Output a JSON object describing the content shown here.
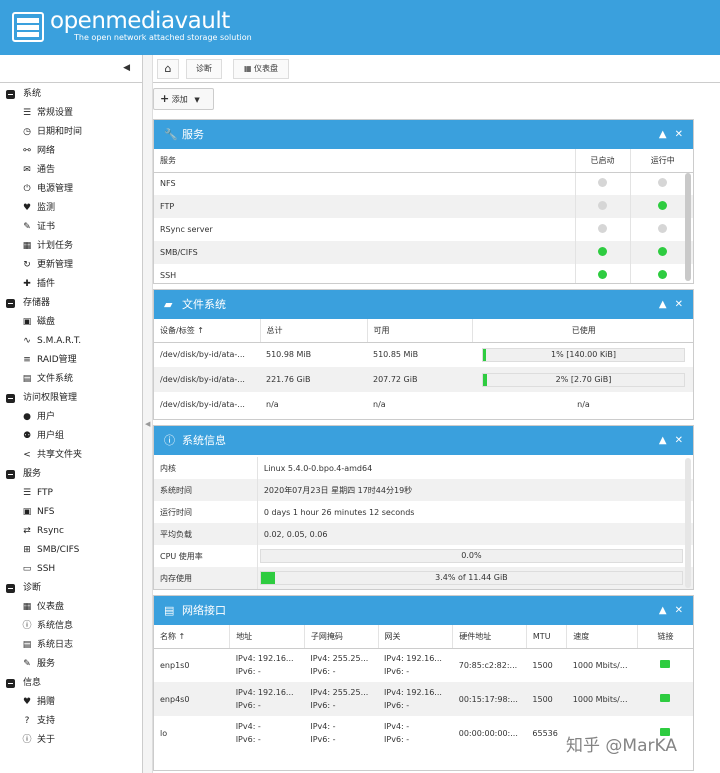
{
  "app": {
    "brand": "openmediavault",
    "tagline": "The open network attached storage solution"
  },
  "toolbar": {
    "home_icon": "home-icon",
    "crumb1": "诊断",
    "crumb2": "仪表盘",
    "add_label": "添加"
  },
  "sidebar": [
    {
      "group": "系统",
      "items": [
        {
          "icon": "☰",
          "label": "常规设置"
        },
        {
          "icon": "◷",
          "label": "日期和时间"
        },
        {
          "icon": "⚯",
          "label": "网络"
        },
        {
          "icon": "✉",
          "label": "通告"
        },
        {
          "icon": "⏻",
          "label": "电源管理"
        },
        {
          "icon": "♥",
          "label": "监测"
        },
        {
          "icon": "✎",
          "label": "证书"
        },
        {
          "icon": "▦",
          "label": "计划任务"
        },
        {
          "icon": "↻",
          "label": "更新管理"
        },
        {
          "icon": "✚",
          "label": "插件"
        }
      ]
    },
    {
      "group": "存储器",
      "items": [
        {
          "icon": "▣",
          "label": "磁盘"
        },
        {
          "icon": "∿",
          "label": "S.M.A.R.T."
        },
        {
          "icon": "≡",
          "label": "RAID管理"
        },
        {
          "icon": "▤",
          "label": "文件系统"
        }
      ]
    },
    {
      "group": "访问权限管理",
      "items": [
        {
          "icon": "●",
          "label": "用户"
        },
        {
          "icon": "⚉",
          "label": "用户组"
        },
        {
          "icon": "<",
          "label": "共享文件夹"
        }
      ]
    },
    {
      "group": "服务",
      "items": [
        {
          "icon": "☰",
          "label": "FTP"
        },
        {
          "icon": "▣",
          "label": "NFS"
        },
        {
          "icon": "⇄",
          "label": "Rsync"
        },
        {
          "icon": "⊞",
          "label": "SMB/CIFS"
        },
        {
          "icon": "▭",
          "label": "SSH"
        }
      ]
    },
    {
      "group": "诊断",
      "items": [
        {
          "icon": "▦",
          "label": "仪表盘"
        },
        {
          "icon": "ⓘ",
          "label": "系统信息"
        },
        {
          "icon": "▤",
          "label": "系统日志"
        },
        {
          "icon": "✎",
          "label": "服务"
        }
      ]
    },
    {
      "group": "信息",
      "items": [
        {
          "icon": "♥",
          "label": "捐赠"
        },
        {
          "icon": "?",
          "label": "支持"
        },
        {
          "icon": "ⓘ",
          "label": "关于"
        }
      ]
    }
  ],
  "services": {
    "title": "服务",
    "headers": [
      "服务",
      "已启动",
      "运行中"
    ],
    "rows": [
      {
        "name": "NFS",
        "enabled": false,
        "running": false
      },
      {
        "name": "FTP",
        "enabled": false,
        "running": true
      },
      {
        "name": "RSync server",
        "enabled": false,
        "running": false
      },
      {
        "name": "SMB/CIFS",
        "enabled": true,
        "running": true
      },
      {
        "name": "SSH",
        "enabled": true,
        "running": true
      }
    ]
  },
  "filesystems": {
    "title": "文件系统",
    "headers": [
      "设备/标签",
      "总计",
      "可用",
      "已使用"
    ],
    "rows": [
      {
        "device": "/dev/disk/by-id/ata-...",
        "total": "510.98 MiB",
        "avail": "510.85 MiB",
        "used_text": "1% [140.00 KiB]",
        "used_pct": 1
      },
      {
        "device": "/dev/disk/by-id/ata-...",
        "total": "221.76 GiB",
        "avail": "207.72 GiB",
        "used_text": "2% [2.70 GiB]",
        "used_pct": 2
      },
      {
        "device": "/dev/disk/by-id/ata-...",
        "total": "n/a",
        "avail": "n/a",
        "used_text": "n/a",
        "used_pct": null
      }
    ]
  },
  "sysinfo": {
    "title": "系统信息",
    "rows": [
      {
        "k": "内核",
        "v": "Linux 5.4.0-0.bpo.4-amd64"
      },
      {
        "k": "系统时间",
        "v": "2020年07月23日 星期四 17时44分19秒"
      },
      {
        "k": "运行时间",
        "v": "0 days 1 hour 26 minutes 12 seconds"
      },
      {
        "k": "平均负载",
        "v": "0.02, 0.05, 0.06"
      },
      {
        "k": "CPU 使用率",
        "bar": "0.0%",
        "pct": 0
      },
      {
        "k": "内存使用",
        "bar": "3.4% of 11.44 GiB",
        "pct": 3.4
      }
    ]
  },
  "network": {
    "title": "网络接口",
    "headers": [
      "名称",
      "地址",
      "子网掩码",
      "网关",
      "硬件地址",
      "MTU",
      "速度",
      "链接"
    ],
    "rows": [
      {
        "name": "enp1s0",
        "addr": [
          "IPv4: 192.16...",
          "IPv6: -"
        ],
        "mask": [
          "IPv4: 255.25...",
          "IPv6: -"
        ],
        "gw": [
          "IPv4: 192.16...",
          "IPv6: -"
        ],
        "hw": "70:85:c2:82:...",
        "mtu": "1500",
        "speed": "1000 Mbits/...",
        "link": true
      },
      {
        "name": "enp4s0",
        "addr": [
          "IPv4: 192.16...",
          "IPv6: -"
        ],
        "mask": [
          "IPv4: 255.25...",
          "IPv6: -"
        ],
        "gw": [
          "IPv4: 192.16...",
          "IPv6: -"
        ],
        "hw": "00:15:17:98:...",
        "mtu": "1500",
        "speed": "1000 Mbits/...",
        "link": true
      },
      {
        "name": "lo",
        "addr": [
          "IPv4: -",
          "IPv6: -"
        ],
        "mask": [
          "IPv4: -",
          "IPv6: -"
        ],
        "gw": [
          "IPv4: -",
          "IPv6: -"
        ],
        "hw": "00:00:00:00:...",
        "mtu": "65536",
        "speed": "",
        "link": true
      }
    ]
  },
  "watermark": "知乎 @MarKA",
  "colors": {
    "accent": "#3aa0dd",
    "ok": "#2ecc40",
    "off": "#d6d6d6"
  }
}
